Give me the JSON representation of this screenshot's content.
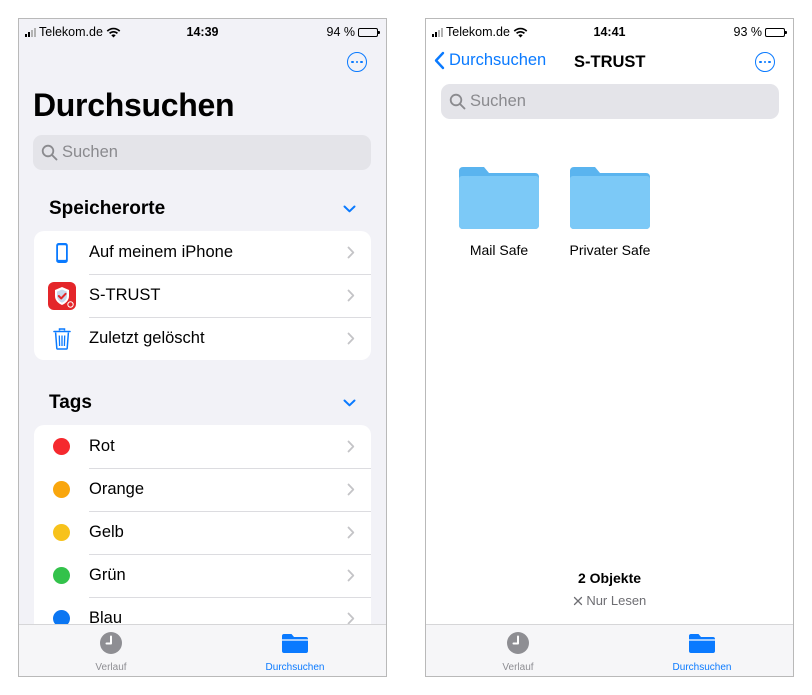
{
  "colors": {
    "accent": "#0a7aff",
    "tag_red": "#f5292e",
    "tag_orange": "#f9a60d",
    "tag_yellow": "#f7c21b",
    "tag_green": "#33c24b",
    "tag_blue": "#0b76f2"
  },
  "left": {
    "status": {
      "carrier": "Telekom.de",
      "time": "14:39",
      "battery": "94 %",
      "battery_level": 0.94
    },
    "title": "Durchsuchen",
    "search_placeholder": "Suchen",
    "locations": {
      "header": "Speicherorte",
      "items": [
        {
          "label": "Auf meinem iPhone",
          "icon": "iphone-icon"
        },
        {
          "label": "S-TRUST",
          "icon": "s-trust-app-icon"
        },
        {
          "label": "Zuletzt gelöscht",
          "icon": "trash-icon"
        }
      ]
    },
    "tags": {
      "header": "Tags",
      "items": [
        {
          "label": "Rot",
          "color": "#f5292e"
        },
        {
          "label": "Orange",
          "color": "#f9a60d"
        },
        {
          "label": "Gelb",
          "color": "#f7c21b"
        },
        {
          "label": "Grün",
          "color": "#33c24b"
        },
        {
          "label": "Blau",
          "color": "#0b76f2"
        }
      ]
    },
    "tabbar": {
      "recent": "Verlauf",
      "browse": "Durchsuchen",
      "active": "browse"
    }
  },
  "right": {
    "status": {
      "carrier": "Telekom.de",
      "time": "14:41",
      "battery": "93 %",
      "battery_level": 0.93
    },
    "nav": {
      "back_label": "Durchsuchen",
      "title": "S-TRUST"
    },
    "search_placeholder": "Suchen",
    "folders": [
      {
        "name": "Mail Safe"
      },
      {
        "name": "Privater Safe"
      }
    ],
    "footer": {
      "count": "2 Objekte",
      "read_only": "Nur Lesen"
    },
    "tabbar": {
      "recent": "Verlauf",
      "browse": "Durchsuchen",
      "active": "browse"
    }
  }
}
